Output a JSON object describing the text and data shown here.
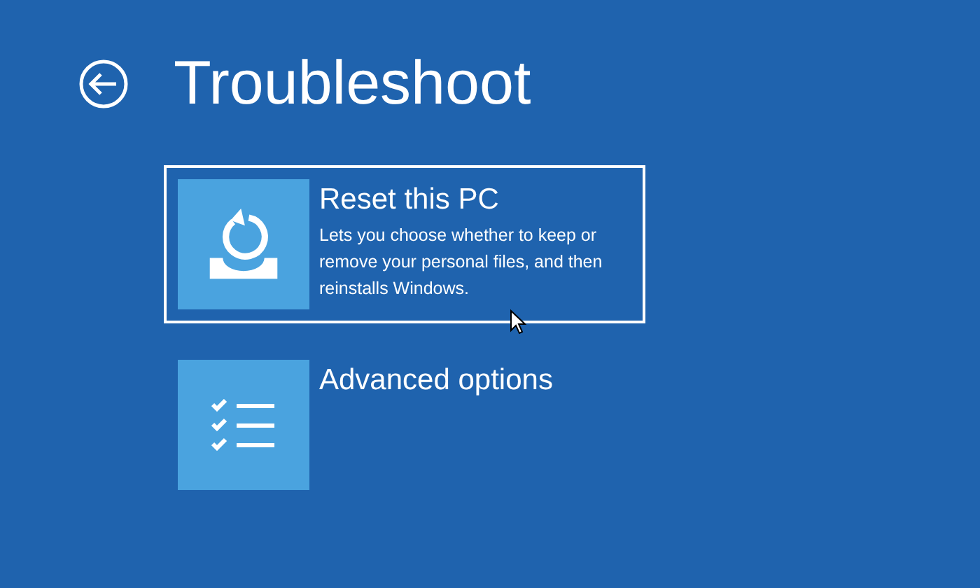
{
  "title": "Troubleshoot",
  "options": [
    {
      "kind": "reset",
      "title": "Reset this PC",
      "description": "Lets you choose whether to keep or remove your personal files, and then reinstalls Windows.",
      "focused": true
    },
    {
      "kind": "checklist",
      "title": "Advanced options",
      "focused": false
    }
  ]
}
